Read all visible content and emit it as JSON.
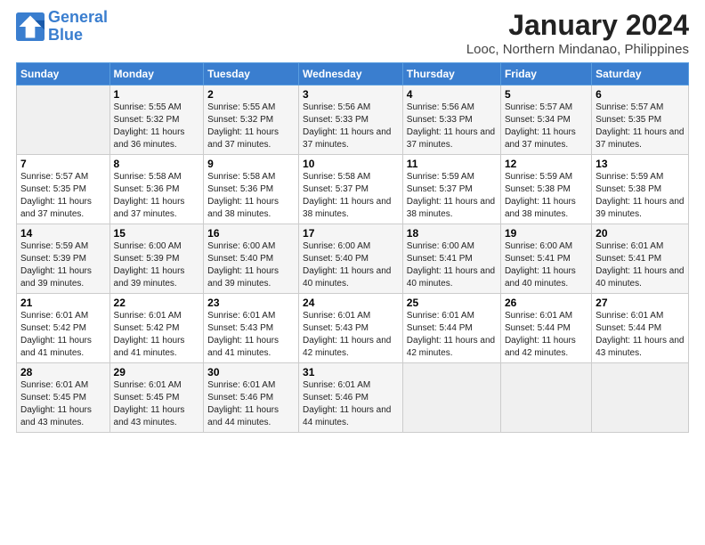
{
  "logo": {
    "line1": "General",
    "line2": "Blue"
  },
  "title": "January 2024",
  "subtitle": "Looc, Northern Mindanao, Philippines",
  "days_header": [
    "Sunday",
    "Monday",
    "Tuesday",
    "Wednesday",
    "Thursday",
    "Friday",
    "Saturday"
  ],
  "weeks": [
    [
      {
        "num": "",
        "sunrise": "",
        "sunset": "",
        "daylight": ""
      },
      {
        "num": "1",
        "sunrise": "Sunrise: 5:55 AM",
        "sunset": "Sunset: 5:32 PM",
        "daylight": "Daylight: 11 hours and 36 minutes."
      },
      {
        "num": "2",
        "sunrise": "Sunrise: 5:55 AM",
        "sunset": "Sunset: 5:32 PM",
        "daylight": "Daylight: 11 hours and 37 minutes."
      },
      {
        "num": "3",
        "sunrise": "Sunrise: 5:56 AM",
        "sunset": "Sunset: 5:33 PM",
        "daylight": "Daylight: 11 hours and 37 minutes."
      },
      {
        "num": "4",
        "sunrise": "Sunrise: 5:56 AM",
        "sunset": "Sunset: 5:33 PM",
        "daylight": "Daylight: 11 hours and 37 minutes."
      },
      {
        "num": "5",
        "sunrise": "Sunrise: 5:57 AM",
        "sunset": "Sunset: 5:34 PM",
        "daylight": "Daylight: 11 hours and 37 minutes."
      },
      {
        "num": "6",
        "sunrise": "Sunrise: 5:57 AM",
        "sunset": "Sunset: 5:35 PM",
        "daylight": "Daylight: 11 hours and 37 minutes."
      }
    ],
    [
      {
        "num": "7",
        "sunrise": "Sunrise: 5:57 AM",
        "sunset": "Sunset: 5:35 PM",
        "daylight": "Daylight: 11 hours and 37 minutes."
      },
      {
        "num": "8",
        "sunrise": "Sunrise: 5:58 AM",
        "sunset": "Sunset: 5:36 PM",
        "daylight": "Daylight: 11 hours and 37 minutes."
      },
      {
        "num": "9",
        "sunrise": "Sunrise: 5:58 AM",
        "sunset": "Sunset: 5:36 PM",
        "daylight": "Daylight: 11 hours and 38 minutes."
      },
      {
        "num": "10",
        "sunrise": "Sunrise: 5:58 AM",
        "sunset": "Sunset: 5:37 PM",
        "daylight": "Daylight: 11 hours and 38 minutes."
      },
      {
        "num": "11",
        "sunrise": "Sunrise: 5:59 AM",
        "sunset": "Sunset: 5:37 PM",
        "daylight": "Daylight: 11 hours and 38 minutes."
      },
      {
        "num": "12",
        "sunrise": "Sunrise: 5:59 AM",
        "sunset": "Sunset: 5:38 PM",
        "daylight": "Daylight: 11 hours and 38 minutes."
      },
      {
        "num": "13",
        "sunrise": "Sunrise: 5:59 AM",
        "sunset": "Sunset: 5:38 PM",
        "daylight": "Daylight: 11 hours and 39 minutes."
      }
    ],
    [
      {
        "num": "14",
        "sunrise": "Sunrise: 5:59 AM",
        "sunset": "Sunset: 5:39 PM",
        "daylight": "Daylight: 11 hours and 39 minutes."
      },
      {
        "num": "15",
        "sunrise": "Sunrise: 6:00 AM",
        "sunset": "Sunset: 5:39 PM",
        "daylight": "Daylight: 11 hours and 39 minutes."
      },
      {
        "num": "16",
        "sunrise": "Sunrise: 6:00 AM",
        "sunset": "Sunset: 5:40 PM",
        "daylight": "Daylight: 11 hours and 39 minutes."
      },
      {
        "num": "17",
        "sunrise": "Sunrise: 6:00 AM",
        "sunset": "Sunset: 5:40 PM",
        "daylight": "Daylight: 11 hours and 40 minutes."
      },
      {
        "num": "18",
        "sunrise": "Sunrise: 6:00 AM",
        "sunset": "Sunset: 5:41 PM",
        "daylight": "Daylight: 11 hours and 40 minutes."
      },
      {
        "num": "19",
        "sunrise": "Sunrise: 6:00 AM",
        "sunset": "Sunset: 5:41 PM",
        "daylight": "Daylight: 11 hours and 40 minutes."
      },
      {
        "num": "20",
        "sunrise": "Sunrise: 6:01 AM",
        "sunset": "Sunset: 5:41 PM",
        "daylight": "Daylight: 11 hours and 40 minutes."
      }
    ],
    [
      {
        "num": "21",
        "sunrise": "Sunrise: 6:01 AM",
        "sunset": "Sunset: 5:42 PM",
        "daylight": "Daylight: 11 hours and 41 minutes."
      },
      {
        "num": "22",
        "sunrise": "Sunrise: 6:01 AM",
        "sunset": "Sunset: 5:42 PM",
        "daylight": "Daylight: 11 hours and 41 minutes."
      },
      {
        "num": "23",
        "sunrise": "Sunrise: 6:01 AM",
        "sunset": "Sunset: 5:43 PM",
        "daylight": "Daylight: 11 hours and 41 minutes."
      },
      {
        "num": "24",
        "sunrise": "Sunrise: 6:01 AM",
        "sunset": "Sunset: 5:43 PM",
        "daylight": "Daylight: 11 hours and 42 minutes."
      },
      {
        "num": "25",
        "sunrise": "Sunrise: 6:01 AM",
        "sunset": "Sunset: 5:44 PM",
        "daylight": "Daylight: 11 hours and 42 minutes."
      },
      {
        "num": "26",
        "sunrise": "Sunrise: 6:01 AM",
        "sunset": "Sunset: 5:44 PM",
        "daylight": "Daylight: 11 hours and 42 minutes."
      },
      {
        "num": "27",
        "sunrise": "Sunrise: 6:01 AM",
        "sunset": "Sunset: 5:44 PM",
        "daylight": "Daylight: 11 hours and 43 minutes."
      }
    ],
    [
      {
        "num": "28",
        "sunrise": "Sunrise: 6:01 AM",
        "sunset": "Sunset: 5:45 PM",
        "daylight": "Daylight: 11 hours and 43 minutes."
      },
      {
        "num": "29",
        "sunrise": "Sunrise: 6:01 AM",
        "sunset": "Sunset: 5:45 PM",
        "daylight": "Daylight: 11 hours and 43 minutes."
      },
      {
        "num": "30",
        "sunrise": "Sunrise: 6:01 AM",
        "sunset": "Sunset: 5:46 PM",
        "daylight": "Daylight: 11 hours and 44 minutes."
      },
      {
        "num": "31",
        "sunrise": "Sunrise: 6:01 AM",
        "sunset": "Sunset: 5:46 PM",
        "daylight": "Daylight: 11 hours and 44 minutes."
      },
      {
        "num": "",
        "sunrise": "",
        "sunset": "",
        "daylight": ""
      },
      {
        "num": "",
        "sunrise": "",
        "sunset": "",
        "daylight": ""
      },
      {
        "num": "",
        "sunrise": "",
        "sunset": "",
        "daylight": ""
      }
    ]
  ]
}
